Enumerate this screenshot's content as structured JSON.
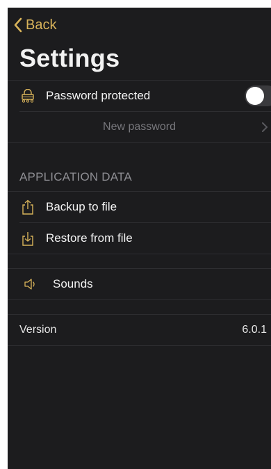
{
  "nav": {
    "back_label": "Back",
    "title": "Settings"
  },
  "security": {
    "password_protected_label": "Password protected",
    "password_protected_on": false,
    "new_password_label": "New password"
  },
  "application_data": {
    "header": "APPLICATION DATA",
    "backup_label": "Backup to file",
    "restore_label": "Restore from file"
  },
  "sounds": {
    "label": "Sounds"
  },
  "about": {
    "version_label": "Version",
    "version_value": "6.0.1"
  },
  "colors": {
    "accent": "#d8b35a",
    "background": "#1c1c1e",
    "separator": "#2e2e31",
    "secondary_text": "#8e8e93"
  }
}
